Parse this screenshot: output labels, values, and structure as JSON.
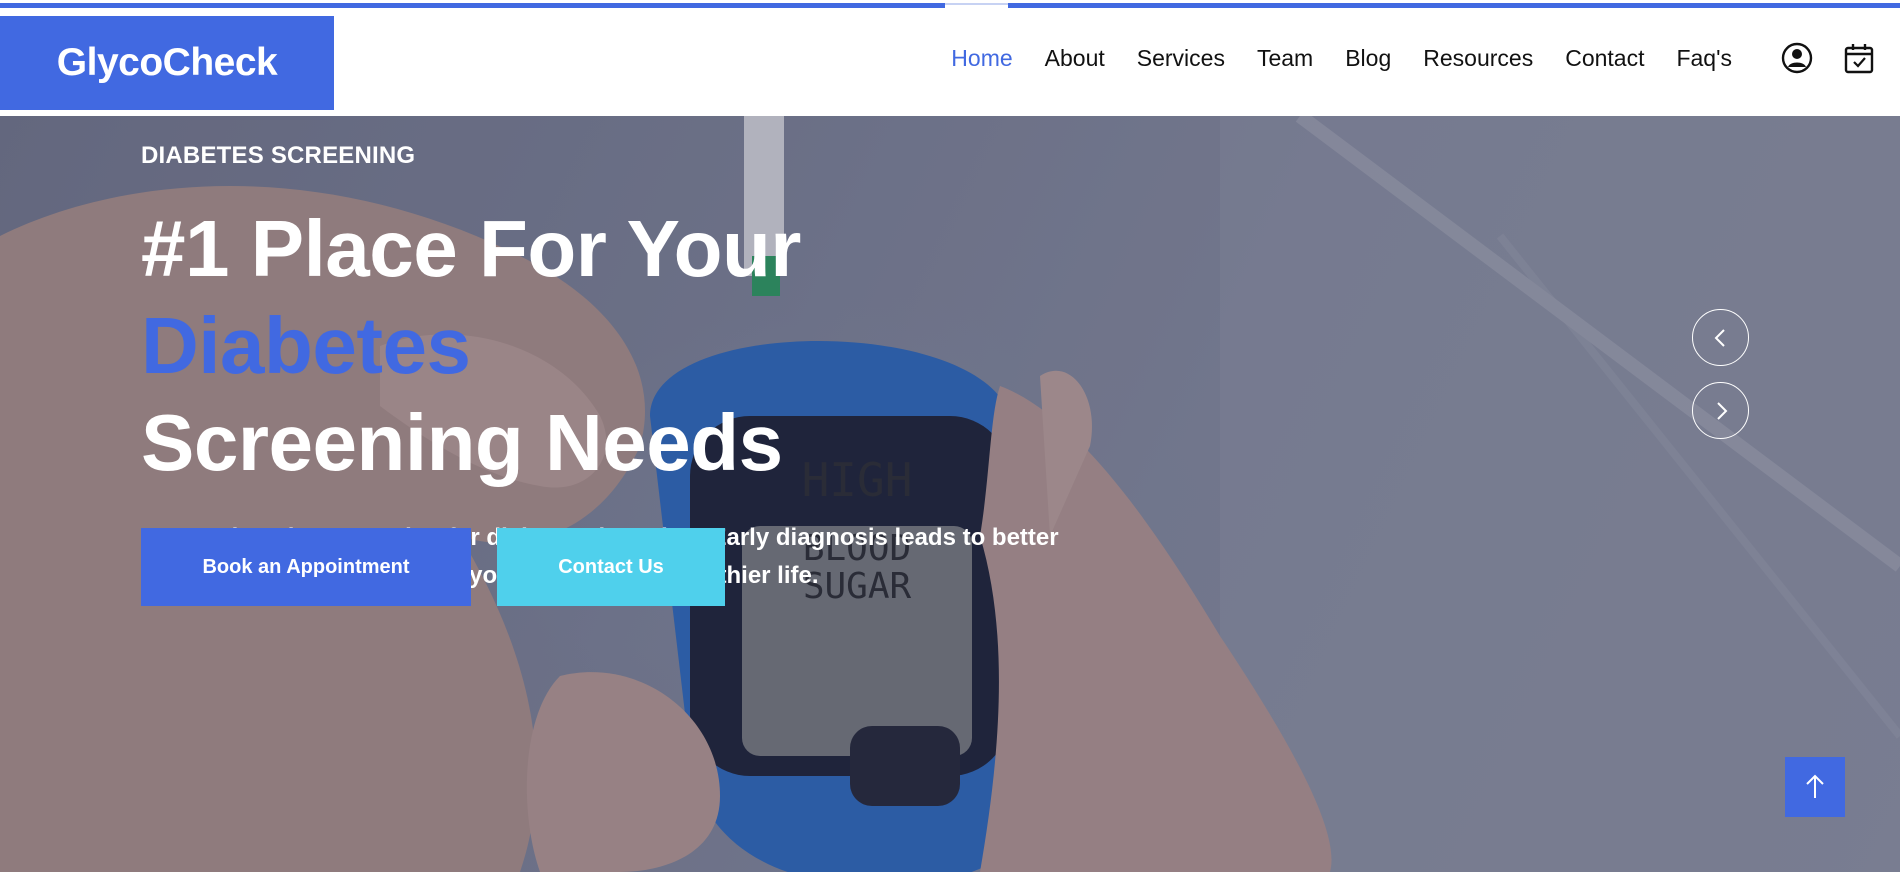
{
  "brand": {
    "name": "GlycoCheck"
  },
  "nav": {
    "items": [
      {
        "label": "Home",
        "active": true
      },
      {
        "label": "About"
      },
      {
        "label": "Services"
      },
      {
        "label": "Team"
      },
      {
        "label": "Blog"
      },
      {
        "label": "Resources"
      },
      {
        "label": "Contact"
      },
      {
        "label": "Faq's"
      }
    ],
    "icons": [
      "user-icon",
      "calendar-check-icon"
    ]
  },
  "hero": {
    "eyebrow": "DIABETES SCREENING",
    "headline_part1": "#1 Place For Your ",
    "headline_accent": "Diabetes",
    "headline_part2": "Screening Needs",
    "description": "Comprehensive screening for diabetes detection. Early diagnosis leads to better management and care. Start your journey to a healthier life.",
    "primary_cta": "Book an Appointment",
    "secondary_cta": "Contact Us",
    "meter_display": [
      "HIGH",
      "BLOOD",
      "SUGAR"
    ],
    "slider_icons": [
      "chevron-left-icon",
      "chevron-right-icon"
    ]
  },
  "back_to_top_icon": "arrow-up-icon",
  "colors": {
    "accent": "#4169e1",
    "secondary": "#4fd0ec",
    "text": "#111111",
    "white": "#ffffff"
  }
}
